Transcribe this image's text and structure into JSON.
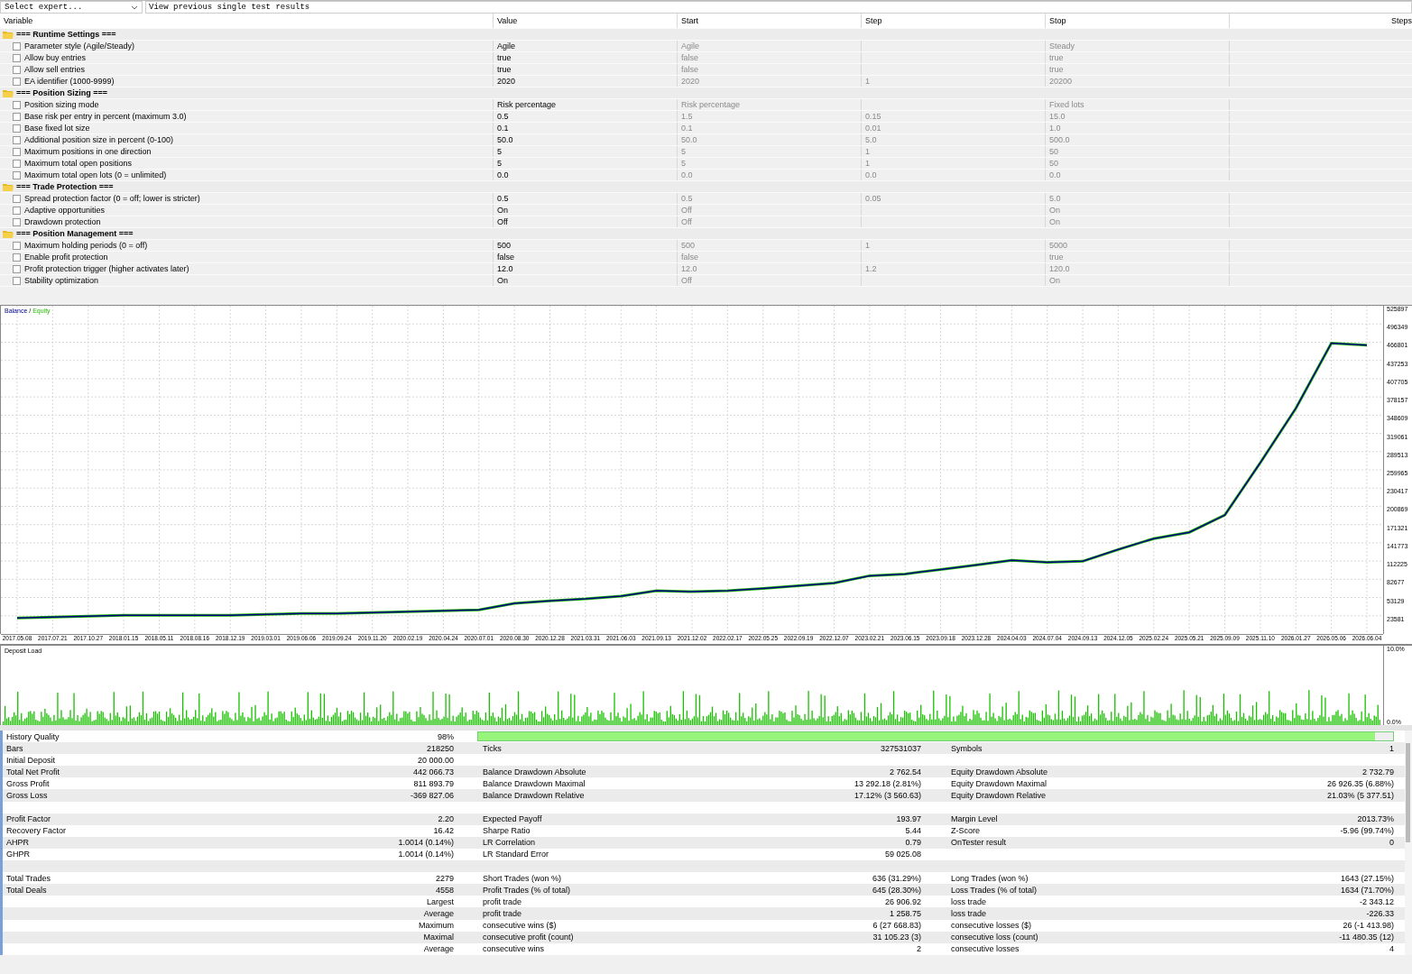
{
  "toolbar": {
    "expert_select": "Select expert...",
    "results_field": "View previous single test results"
  },
  "inputs_table": {
    "columns": [
      "Variable",
      "Value",
      "Start",
      "Step",
      "Stop",
      "Steps"
    ],
    "groups": [
      {
        "title": "=== Runtime Settings ===",
        "rows": [
          {
            "name": "Parameter style (Agile/Steady)",
            "value": "Agile",
            "start": "Agile",
            "stop": "Steady",
            "checked": false
          },
          {
            "name": "Allow buy entries",
            "value": "true",
            "start": "false",
            "stop": "true",
            "checked": false
          },
          {
            "name": "Allow sell entries",
            "value": "true",
            "start": "false",
            "stop": "true",
            "checked": false
          },
          {
            "name": "EA identifier (1000-9999)",
            "value": "2020",
            "start": "2020",
            "step": "1",
            "stop": "20200",
            "checked": false
          }
        ]
      },
      {
        "title": "=== Position Sizing ===",
        "rows": [
          {
            "name": "Position sizing mode",
            "value": "Risk percentage",
            "start": "Risk percentage",
            "stop": "Fixed lots",
            "checked": false
          },
          {
            "name": "Base risk per entry in percent (maximum 3.0)",
            "value": "0.5",
            "start": "1.5",
            "step": "0.15",
            "stop": "15.0",
            "checked": false
          },
          {
            "name": "Base fixed lot size",
            "value": "0.1",
            "start": "0.1",
            "step": "0.01",
            "stop": "1.0",
            "checked": false
          },
          {
            "name": "Additional position size in percent (0-100)",
            "value": "50.0",
            "start": "50.0",
            "step": "5.0",
            "stop": "500.0",
            "checked": false
          },
          {
            "name": "Maximum positions in one direction",
            "value": "5",
            "start": "5",
            "step": "1",
            "stop": "50",
            "checked": false
          },
          {
            "name": "Maximum total open positions",
            "value": "5",
            "start": "5",
            "step": "1",
            "stop": "50",
            "checked": false
          },
          {
            "name": "Maximum total open lots (0 = unlimited)",
            "value": "0.0",
            "start": "0.0",
            "step": "0.0",
            "stop": "0.0",
            "checked": false
          }
        ]
      },
      {
        "title": "=== Trade Protection ===",
        "rows": [
          {
            "name": "Spread protection factor (0 = off; lower is stricter)",
            "value": "0.5",
            "start": "0.5",
            "step": "0.05",
            "stop": "5.0",
            "checked": false
          },
          {
            "name": "Adaptive opportunities",
            "value": "On",
            "start": "Off",
            "stop": "On",
            "checked": false
          },
          {
            "name": "Drawdown protection",
            "value": "Off",
            "start": "Off",
            "stop": "On",
            "checked": false
          }
        ]
      },
      {
        "title": "=== Position Management ===",
        "rows": [
          {
            "name": "Maximum holding periods (0 = off)",
            "value": "500",
            "start": "500",
            "step": "1",
            "stop": "5000",
            "checked": false
          },
          {
            "name": "Enable profit protection",
            "value": "false",
            "start": "false",
            "stop": "true",
            "checked": false
          },
          {
            "name": "Profit protection trigger (higher activates later)",
            "value": "12.0",
            "start": "12.0",
            "step": "1.2",
            "stop": "120.0",
            "checked": false
          },
          {
            "name": "Stability optimization",
            "value": "On",
            "start": "Off",
            "stop": "On",
            "checked": false
          }
        ]
      }
    ]
  },
  "graph": {
    "legend_separator": "/",
    "chart_data": {
      "type": "line",
      "grid": true,
      "ylim": [
        -5967,
        525897
      ],
      "yticks": [
        525897,
        496349,
        466801,
        437253,
        407705,
        378157,
        348609,
        319061,
        289513,
        259965,
        230417,
        200869,
        171321,
        141773,
        112225,
        82677,
        53129,
        23581
      ],
      "categories": [
        "2017.05.08",
        "2017.07.21",
        "2017.10.27",
        "2018.01.15",
        "2018.05.11",
        "2018.08.16",
        "2018.12.19",
        "2019.03.01",
        "2019.06.06",
        "2019.09.24",
        "2019.11.20",
        "2020.02.19",
        "2020.04.24",
        "2020.07.01",
        "2020.08.30",
        "2020.12.28",
        "2021.03.31",
        "2021.06.03",
        "2021.09.13",
        "2021.12.02",
        "2022.02.17",
        "2022.05.25",
        "2022.09.19",
        "2022.12.07",
        "2023.02.21",
        "2023.06.15",
        "2023.09.18",
        "2023.12.28",
        "2024.04.03",
        "2024.07.04",
        "2024.09.13",
        "2024.12.05",
        "2025.02.24",
        "2025.05.21",
        "2025.09.09",
        "2025.11.10",
        "2026.01.27",
        "2026.05.06",
        "2026.06.04"
      ],
      "series": [
        {
          "name": "Balance",
          "color": "#00008b",
          "values": [
            20000,
            21500,
            22900,
            24400,
            24400,
            24400,
            24400,
            25900,
            27300,
            27300,
            28800,
            30300,
            31700,
            33200,
            43500,
            47800,
            50800,
            55200,
            64000,
            62500,
            64000,
            67900,
            72300,
            76700,
            88400,
            91400,
            98700,
            106000,
            113400,
            110400,
            111900,
            131000,
            148600,
            158800,
            186700,
            271700,
            359700,
            465300,
            462100
          ]
        },
        {
          "name": "Equity",
          "color": "#22bb00",
          "values": [
            20000,
            21500,
            22900,
            24400,
            24400,
            24400,
            24400,
            25900,
            27300,
            27300,
            28800,
            30300,
            31700,
            33200,
            43500,
            47800,
            50800,
            55200,
            64000,
            62500,
            64000,
            67900,
            72300,
            76700,
            88400,
            91400,
            98700,
            106000,
            113400,
            110400,
            111900,
            131000,
            148600,
            158800,
            186700,
            271700,
            359700,
            465300,
            462100
          ]
        }
      ]
    },
    "deposit_load": {
      "title": "Deposit Load",
      "top_label": "10.0%",
      "bottom_label": "0.0%"
    }
  },
  "report": {
    "rows": [
      {
        "kind": "quality",
        "label": "History Quality",
        "value": "98%",
        "level": 0.98
      },
      {
        "kind": "main",
        "label": "Bars",
        "value": "218250",
        "label_2": "Ticks",
        "value_2": "327531037",
        "label_3": "Symbols",
        "value_3": "1"
      },
      {
        "kind": "main",
        "label": "Initial Deposit",
        "value": "20 000.00"
      },
      {
        "kind": "main",
        "label": "Total Net Profit",
        "value": "442 066.73",
        "label_2": "Balance Drawdown Absolute",
        "value_2": "2 762.54",
        "label_3": "Equity Drawdown Absolute",
        "value_3": "2 732.79"
      },
      {
        "kind": "main",
        "label": "Gross Profit",
        "value": "811 893.79",
        "label_2": "Balance Drawdown Maximal",
        "value_2": "13 292.18 (2.81%)",
        "label_3": "Equity Drawdown Maximal",
        "value_3": "26 926.35 (6.88%)"
      },
      {
        "kind": "main",
        "label": "Gross Loss",
        "value": "-369 827.06",
        "label_2": "Balance Drawdown Relative",
        "value_2": "17.12% (3 560.63)",
        "label_3": "Equity Drawdown Relative",
        "value_3": "21.03% (5 377.51)"
      },
      {
        "kind": "blank"
      },
      {
        "kind": "main",
        "label": "Profit Factor",
        "value": "2.20",
        "label_2": "Expected Payoff",
        "value_2": "193.97",
        "label_3": "Margin Level",
        "value_3": "2013.73%"
      },
      {
        "kind": "main",
        "label": "Recovery Factor",
        "value": "16.42",
        "label_2": "Sharpe Ratio",
        "value_2": "5.44",
        "label_3": "Z-Score",
        "value_3": "-5.96 (99.74%)"
      },
      {
        "kind": "main",
        "label": "AHPR",
        "value": "1.0014 (0.14%)",
        "label_2": "LR Correlation",
        "value_2": "0.79",
        "label_3": "OnTester result",
        "value_3": "0"
      },
      {
        "kind": "main",
        "label": "GHPR",
        "value": "1.0014 (0.14%)",
        "label_2": "LR Standard Error",
        "value_2": "59 025.08"
      },
      {
        "kind": "blank"
      },
      {
        "kind": "main",
        "label": "Total Trades",
        "value": "2279",
        "label_2": "Short Trades (won %)",
        "value_2": "636 (31.29%)",
        "label_3": "Long Trades (won %)",
        "value_3": "1643 (27.15%)"
      },
      {
        "kind": "main",
        "label": "Total Deals",
        "value": "4558",
        "label_2": "Profit Trades (% of total)",
        "value_2": "645 (28.30%)",
        "label_3": "Loss Trades (% of total)",
        "value_3": "1634 (71.70%)"
      },
      {
        "kind": "sub",
        "label": "Largest",
        "label_2": "profit trade",
        "value_2": "26 906.92",
        "label_3": "loss trade",
        "value_3": "-2 343.12"
      },
      {
        "kind": "sub",
        "label": "Average",
        "label_2": "profit trade",
        "value_2": "1 258.75",
        "label_3": "loss trade",
        "value_3": "-226.33"
      },
      {
        "kind": "sub",
        "label": "Maximum",
        "label_2": "consecutive wins ($)",
        "value_2": "6 (27 668.83)",
        "label_3": "consecutive losses ($)",
        "value_3": "26 (-1 413.98)"
      },
      {
        "kind": "sub",
        "label": "Maximal",
        "label_2": "consecutive profit (count)",
        "value_2": "31 105.23 (3)",
        "label_3": "consecutive loss (count)",
        "value_3": "-11 480.35 (12)"
      },
      {
        "kind": "sub",
        "label": "Average",
        "label_2": "consecutive wins",
        "value_2": "2",
        "label_3": "consecutive losses",
        "value_3": "4"
      }
    ]
  }
}
